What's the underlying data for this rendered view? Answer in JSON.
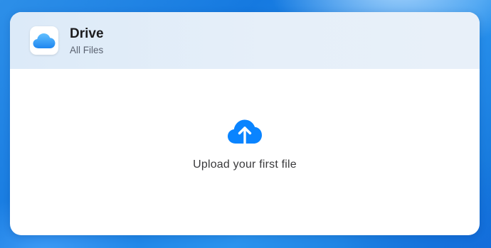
{
  "widget": {
    "app_icon": "icloud-drive-icon",
    "title": "Drive",
    "subtitle": "All Files"
  },
  "upload": {
    "icon": "cloud-upload-icon",
    "label": "Upload your first file"
  },
  "colors": {
    "accent": "#0a84ff",
    "header_background": "#e2edf8",
    "title_text": "#1c1c1e",
    "subtitle_text": "#5a6270",
    "background": "#1579e0"
  }
}
